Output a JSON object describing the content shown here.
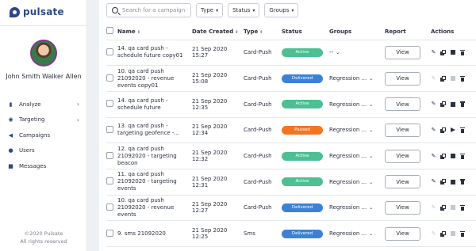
{
  "brand": {
    "name": "pulsate"
  },
  "user": {
    "name": "John Smith Walker Allen"
  },
  "nav": [
    {
      "label": "Analyze",
      "icon": "chart-icon",
      "chevron": true
    },
    {
      "label": "Targeting",
      "icon": "target-icon",
      "chevron": true
    },
    {
      "label": "Campaigns",
      "icon": "megaphone-icon",
      "chevron": false
    },
    {
      "label": "Users",
      "icon": "users-icon",
      "chevron": false
    },
    {
      "label": "Messages",
      "icon": "chat-icon",
      "chevron": false
    }
  ],
  "footer": {
    "line1": "©2020 Pulsate",
    "line2": "All rights reserved"
  },
  "filters": {
    "search_placeholder": "Search for a campaign",
    "type_label": "Type",
    "status_label": "Status",
    "groups_label": "Groups"
  },
  "columns": {
    "name": "Name",
    "date": "Date Created",
    "type": "Type",
    "status": "Status",
    "groups": "Groups",
    "report": "Report",
    "actions": "Actions"
  },
  "view_label": "View",
  "status_colors": {
    "Active": "#4cbf93",
    "Delivered": "#3b82d6",
    "Paused": "#f37520"
  },
  "rows": [
    {
      "name": "14. qa card push - schedule future copy01",
      "date": "21 Sep 2020 15:27",
      "type": "Card-Push",
      "status": "Active",
      "groups": "--",
      "actions": [
        "edit",
        "copy",
        "stop",
        "trash"
      ]
    },
    {
      "name": "10. qa card push 21092020 - revenue events copy01",
      "date": "21 Sep 2020 15:08",
      "type": "Card-Push",
      "status": "Delivered",
      "groups": "Regression ...",
      "actions": [
        "edit-dis",
        "copy",
        "stop-dis",
        "trash"
      ]
    },
    {
      "name": "14. qa card push - schedule future",
      "date": "21 Sep 2020 12:35",
      "type": "Card-Push",
      "status": "Active",
      "groups": "Regression ...",
      "actions": [
        "edit",
        "copy",
        "stop",
        "trash"
      ]
    },
    {
      "name": "13. qa card push - targeting geofence -...",
      "date": "21 Sep 2020 12:34",
      "type": "Card-Push",
      "status": "Paused",
      "groups": "Regression ...",
      "actions": [
        "edit",
        "copy",
        "play",
        "trash"
      ]
    },
    {
      "name": "12. qa card push 21092020 - targeting beacon",
      "date": "21 Sep 2020 12:32",
      "type": "Card-Push",
      "status": "Active",
      "groups": "Regression ...",
      "actions": [
        "edit",
        "copy",
        "stop",
        "trash"
      ]
    },
    {
      "name": "11. qa card push 21092020 - targeting events",
      "date": "21 Sep 2020 12:31",
      "type": "Card-Push",
      "status": "Active",
      "groups": "Regression ...",
      "actions": [
        "edit",
        "copy",
        "stop",
        "trash"
      ]
    },
    {
      "name": "10. qa card push 21092020 - revenue events",
      "date": "21 Sep 2020 12:27",
      "type": "Card-Push",
      "status": "Delivered",
      "groups": "Regression ...",
      "actions": [
        "edit-dis",
        "copy",
        "stop-dis",
        "trash"
      ]
    },
    {
      "name": "9. sms 21092020",
      "date": "21 Sep 2020 12:25",
      "type": "Sms",
      "status": "Delivered",
      "groups": "Regression ...",
      "actions": [
        "edit-dis",
        "copy",
        "stop-dis",
        "trash"
      ]
    }
  ]
}
